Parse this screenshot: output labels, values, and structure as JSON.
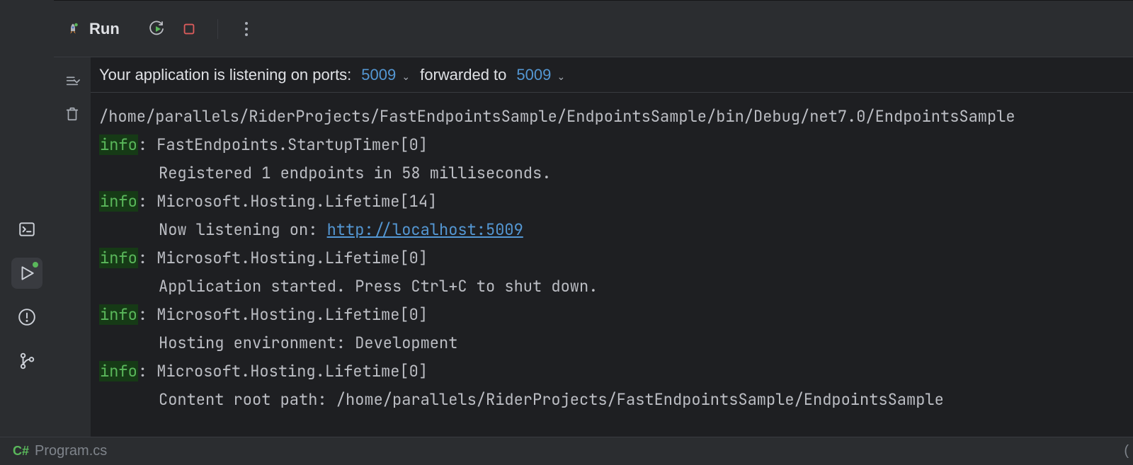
{
  "toolbar": {
    "title": "Run"
  },
  "ports": {
    "label": "Your application is listening on ports:",
    "port": "5009",
    "forwarded_label": "forwarded to",
    "forwarded_port": "5009"
  },
  "log": {
    "info_label": "info",
    "cmd_line": "/home/parallels/RiderProjects/FastEndpointsSample/EndpointsSample/bin/Debug/net7.0/EndpointsSample",
    "entries": [
      {
        "source": "FastEndpoints.StartupTimer[0]",
        "msg": "Registered 1 endpoints in 58 milliseconds."
      },
      {
        "source": "Microsoft.Hosting.Lifetime[14]",
        "msg_prefix": "Now listening on: ",
        "url": "http://localhost:5009"
      },
      {
        "source": "Microsoft.Hosting.Lifetime[0]",
        "msg": "Application started. Press Ctrl+C to shut down."
      },
      {
        "source": "Microsoft.Hosting.Lifetime[0]",
        "msg": "Hosting environment: Development"
      },
      {
        "source": "Microsoft.Hosting.Lifetime[0]",
        "msg": "Content root path: /home/parallels/RiderProjects/FastEndpointsSample/EndpointsSample"
      }
    ]
  },
  "statusbar": {
    "file_icon": "C#",
    "file": "Program.cs"
  }
}
